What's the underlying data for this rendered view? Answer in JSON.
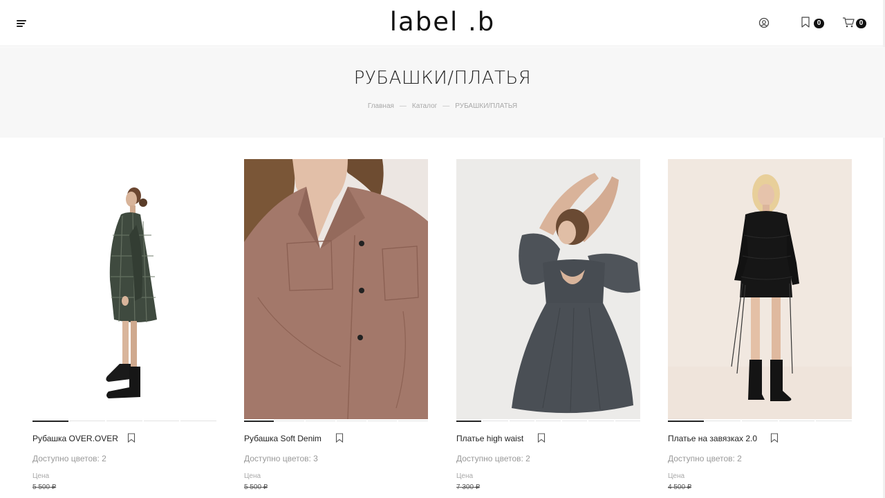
{
  "header": {
    "logo": "label .b",
    "favorites_count": "0",
    "cart_count": "0"
  },
  "page": {
    "title": "РУБАШКИ/ПЛАТЬЯ",
    "breadcrumb": [
      "Главная",
      "Каталог",
      "РУБАШКИ/ПЛАТЬЯ"
    ]
  },
  "products": [
    {
      "name": "Рубашка OVER.OVER",
      "colors": "Доступно цветов: 2",
      "price_label": "Цена",
      "old_price": "5 500 ₽",
      "slides": 5,
      "active_slide": 0
    },
    {
      "name": "Рубашка Soft Denim",
      "colors": "Доступно цветов: 3",
      "price_label": "Цена",
      "old_price": "5 500 ₽",
      "slides": 6,
      "active_slide": 0
    },
    {
      "name": "Платье high waist",
      "colors": "Доступно цветов: 2",
      "price_label": "Цена",
      "old_price": "7 300 ₽",
      "slides": 7,
      "active_slide": 0
    },
    {
      "name": "Платье на завязках 2.0",
      "colors": "Доступно цветов: 2",
      "price_label": "Цена",
      "old_price": "4 500 ₽",
      "slides": 5,
      "active_slide": 0
    }
  ],
  "icons": {
    "menu": "menu-icon",
    "user": "user-icon",
    "favorites": "bookmark-icon",
    "cart": "cart-icon",
    "product_bookmark": "bookmark-icon"
  },
  "colors": {
    "text": "#222222",
    "muted": "#999999",
    "band": "#f7f7f7",
    "badge": "#111111"
  }
}
